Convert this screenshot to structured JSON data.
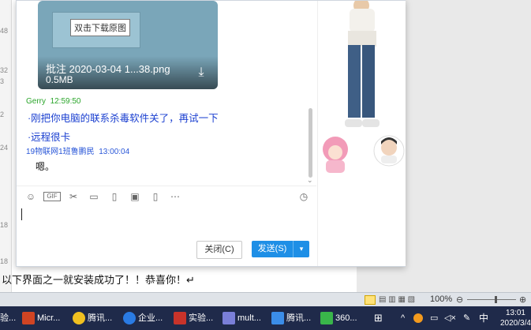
{
  "document": {
    "gutter_numbers": [
      "48",
      "32",
      "3",
      "2",
      "24",
      "18",
      "18"
    ],
    "line_text": "以下界面之一就安装成功了！！恭喜你！↵"
  },
  "chat": {
    "image": {
      "file_name": "批注 2020-03-04 1...38.png",
      "file_size": "0.5MB",
      "tooltip": "双击下载原图"
    },
    "messages": [
      {
        "sender": "Gerry",
        "time": "12:59:50",
        "color": "#2aa52a",
        "lines": [
          "刚把你电脑的联系杀毒软件关了，再试一下",
          "远程很卡"
        ]
      },
      {
        "sender": "19物联网1班鲁鹏民",
        "time": "13:00:04",
        "color": "#2a57d8",
        "lines": [
          "嗯。"
        ]
      }
    ],
    "toolbar_icons": [
      "smile-icon",
      "gif-icon",
      "scissors-icon",
      "folder-icon",
      "file-icon",
      "image-icon",
      "shake-icon",
      "more-icon",
      "history-icon"
    ],
    "buttons": {
      "close": "关闭(C)",
      "send": "发送(S)"
    }
  },
  "status_bar": {
    "zoom": "100%"
  },
  "taskbar": {
    "items": [
      "验...",
      "Micr...",
      "腾讯...",
      "企业...",
      "实验...",
      "mult...",
      "腾讯...",
      "360..."
    ],
    "tray_lang": "中",
    "time": "13:01",
    "date": "2020/3/4"
  },
  "colors": {
    "send_button": "#1e8fe6",
    "link_text": "#1a3fd0"
  }
}
